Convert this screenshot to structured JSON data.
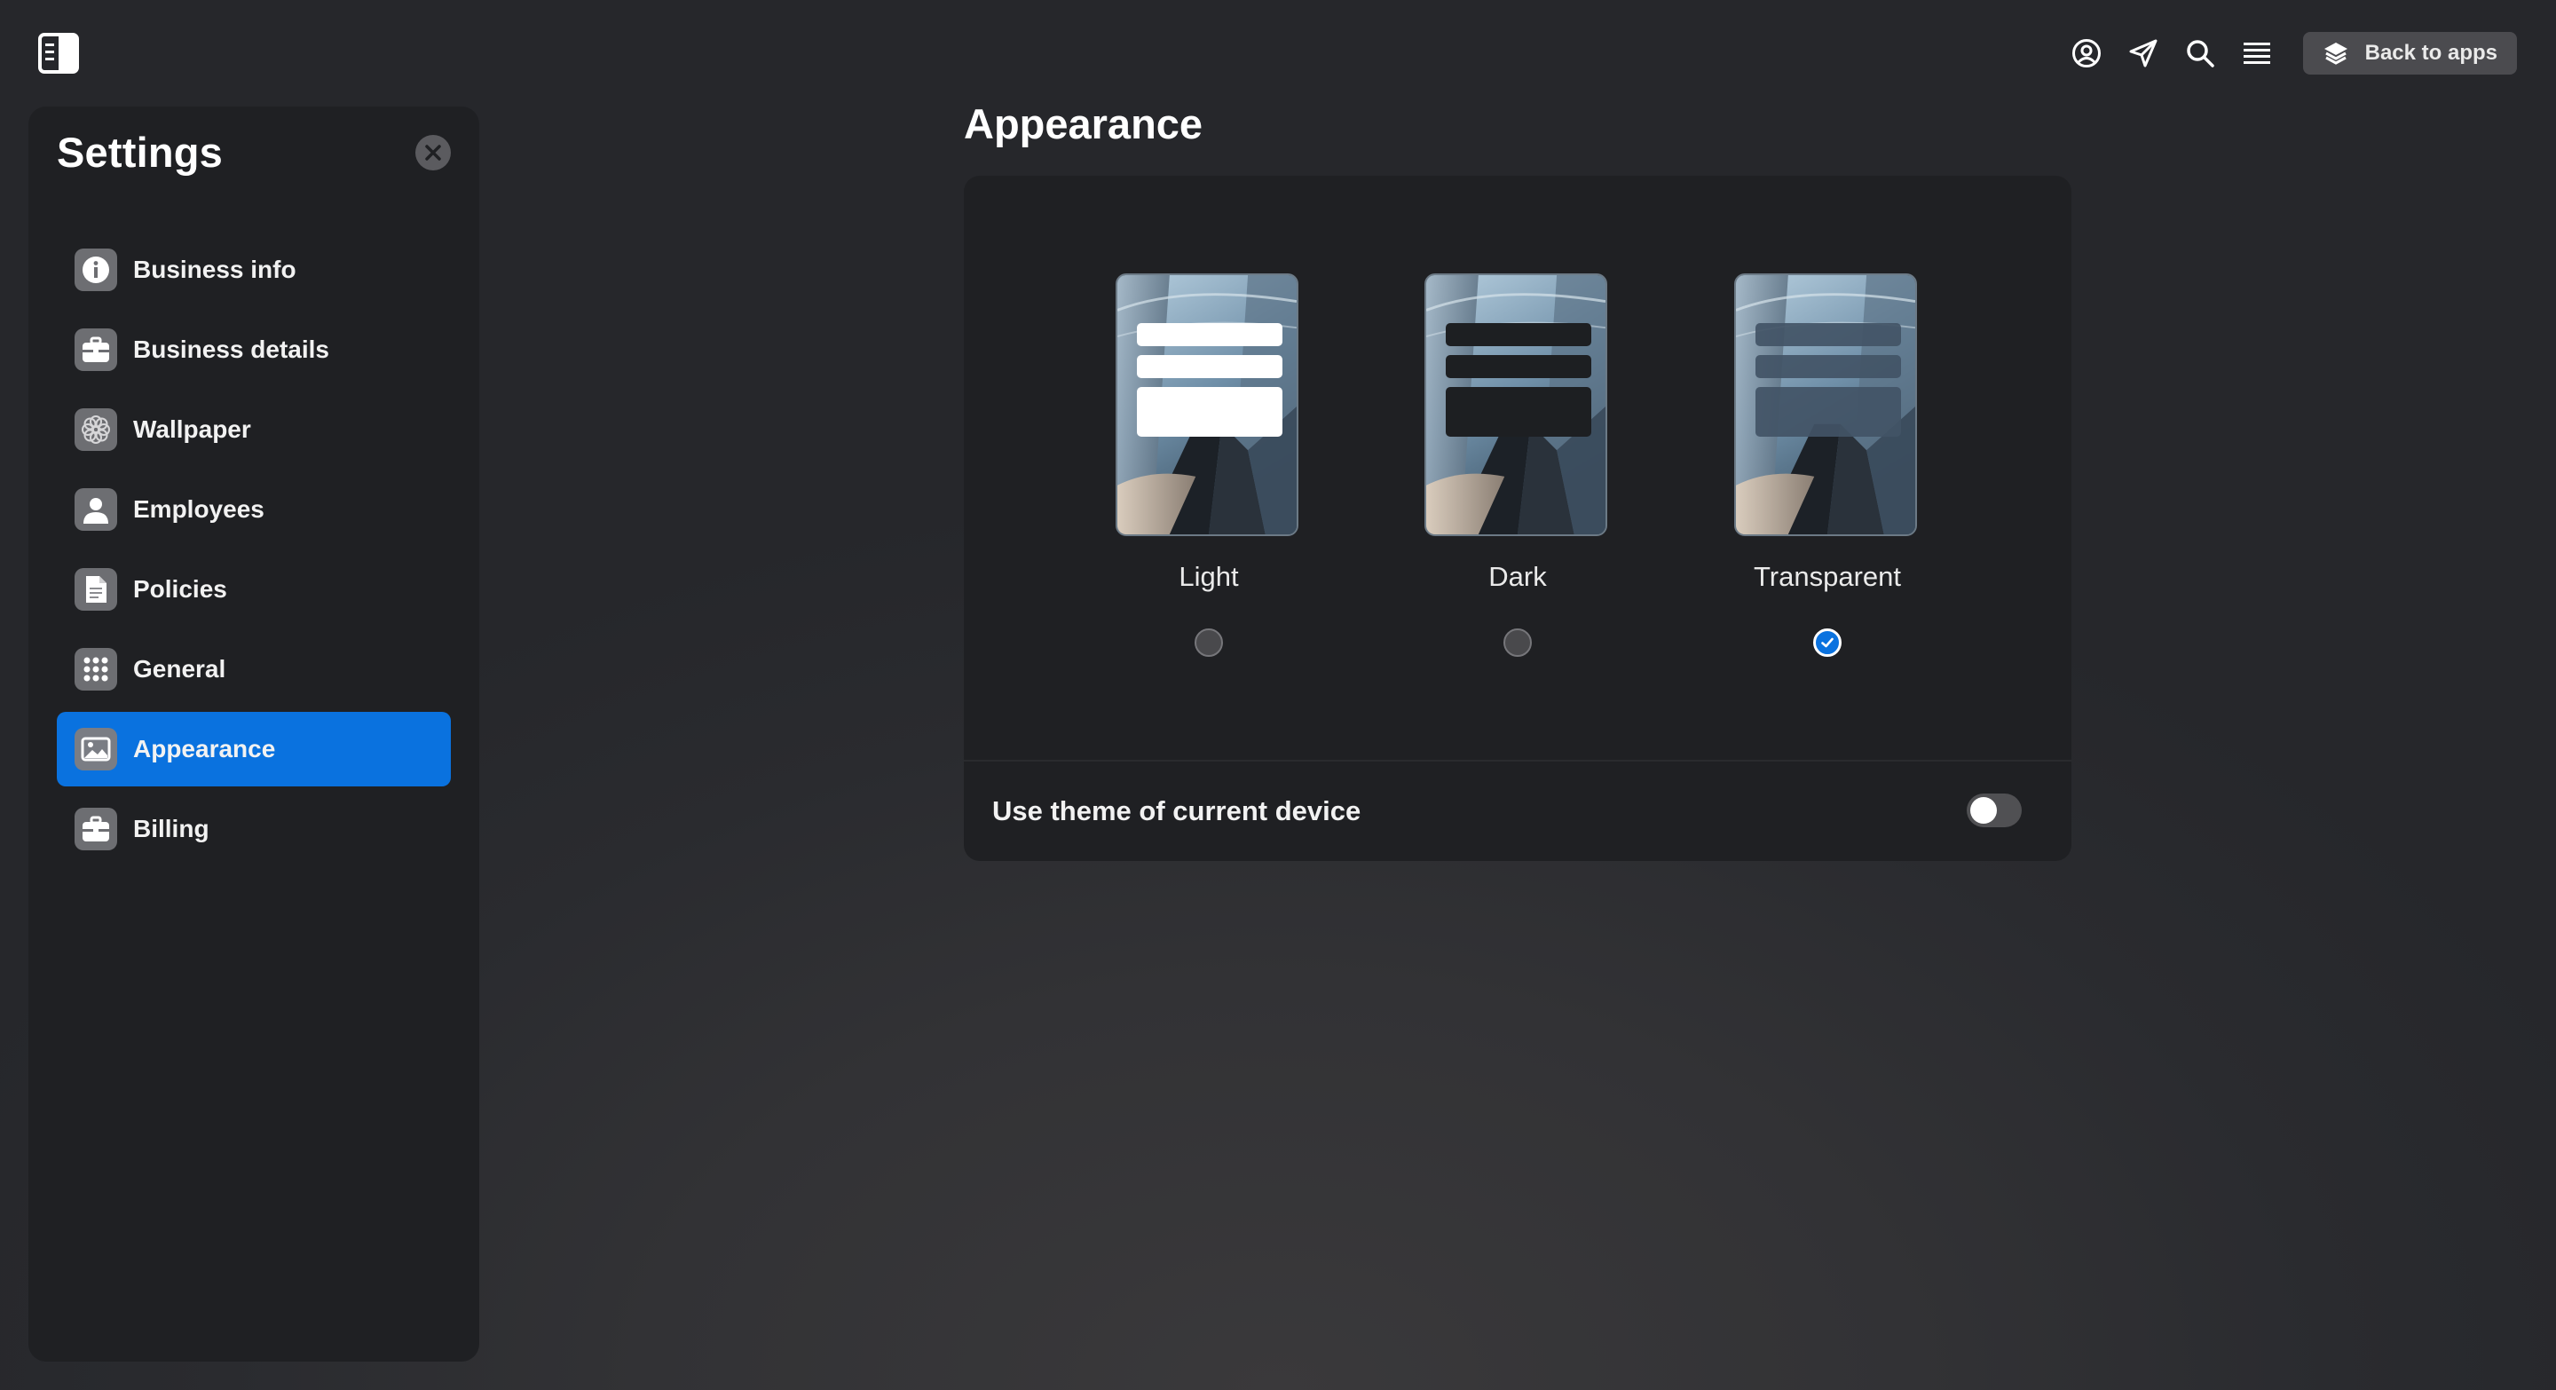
{
  "topbar": {
    "icons": [
      "sidebar-toggle-icon",
      "user-circle-icon",
      "send-icon",
      "search-icon",
      "menu-icon",
      "layers-icon"
    ],
    "back_label": "Back to apps"
  },
  "settings": {
    "title": "Settings",
    "items": [
      {
        "label": "Business info",
        "icon": "info-icon",
        "active": false
      },
      {
        "label": "Business details",
        "icon": "briefcase-icon",
        "active": false
      },
      {
        "label": "Wallpaper",
        "icon": "flower-icon",
        "active": false
      },
      {
        "label": "Employees",
        "icon": "person-icon",
        "active": false
      },
      {
        "label": "Policies",
        "icon": "document-icon",
        "active": false
      },
      {
        "label": "General",
        "icon": "grid-icon",
        "active": false
      },
      {
        "label": "Appearance",
        "icon": "image-icon",
        "active": true
      },
      {
        "label": "Billing",
        "icon": "briefcase-icon",
        "active": false
      }
    ]
  },
  "main": {
    "title": "Appearance",
    "themes": [
      {
        "label": "Light",
        "selected": false
      },
      {
        "label": "Dark",
        "selected": false
      },
      {
        "label": "Transparent",
        "selected": true
      }
    ],
    "device_theme": {
      "label": "Use theme of current device",
      "enabled": false
    }
  },
  "colors": {
    "accent": "#0a72df",
    "panel": "#1f2023",
    "background": "#2a2b2f"
  }
}
